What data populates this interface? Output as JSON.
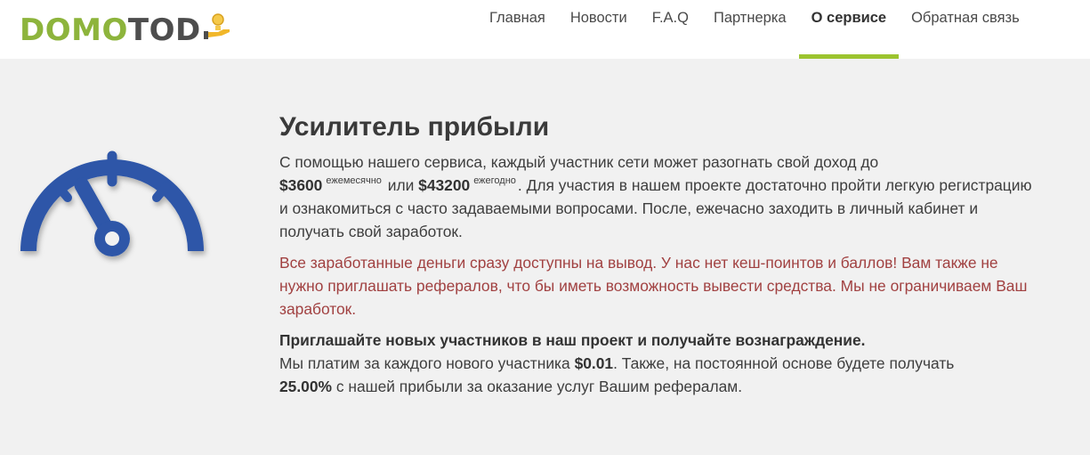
{
  "brand": {
    "part1": "DOMO",
    "part2": "TOD"
  },
  "nav": [
    {
      "label": "Главная",
      "active": false
    },
    {
      "label": "Новости",
      "active": false
    },
    {
      "label": "F.A.Q",
      "active": false
    },
    {
      "label": "Партнерка",
      "active": false
    },
    {
      "label": "О сервисе",
      "active": true
    },
    {
      "label": "Обратная связь",
      "active": false
    }
  ],
  "colors": {
    "accent": "#9cc42f",
    "gauge": "#2d56a8",
    "warning_text": "#a14141"
  },
  "icons": {
    "logo": "coin-hand-icon",
    "hero": "speedometer-icon"
  },
  "section": {
    "title": "Усилитель прибыли",
    "p1": {
      "a": "С помощью нашего сервиса, каждый участник сети может разогнать свой доход до",
      "amount1": "$3600",
      "period1": "ежемесячно",
      "or": "или",
      "amount2": "$43200",
      "period2": "ежегодно",
      "b": ". Для участия в нашем проекте достаточно пройти легкую регистрацию и ознакомиться с часто задаваемыми вопросами. После, ежечасно заходить в личный кабинет и получать свой заработок."
    },
    "p2": "Все заработанные деньги сразу доступны на вывод. У нас нет кеш-поинтов и баллов! Вам также не нужно приглашать рефералов, что бы иметь возможность вывести средства. Мы не ограничиваем Ваш заработок.",
    "p3": {
      "heading": "Приглашайте новых участников в наш проект и получайте вознаграждение.",
      "a": "Мы платим за каждого нового участника",
      "amount": "$0.01",
      "b": ". Также, на постоянной основе будете получать",
      "percent": "25.00%",
      "c": "с нашей прибыли за оказание услуг Вашим рефералам."
    }
  }
}
